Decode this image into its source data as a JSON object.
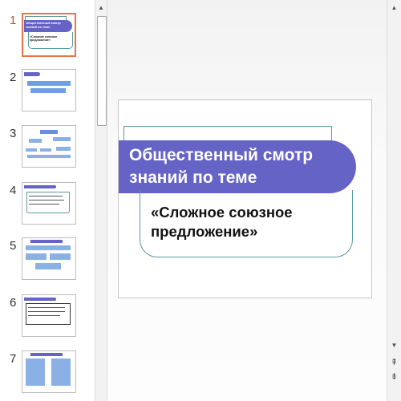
{
  "thumbnails": [
    {
      "number": "1",
      "selected": true,
      "title_text": "Общественный смотр знаний по теме",
      "subtitle_text": "«Сложное союзное предложение»"
    },
    {
      "number": "2",
      "selected": false
    },
    {
      "number": "3",
      "selected": false
    },
    {
      "number": "4",
      "selected": false
    },
    {
      "number": "5",
      "selected": false
    },
    {
      "number": "6",
      "selected": false
    },
    {
      "number": "7",
      "selected": false
    }
  ],
  "slide": {
    "title": "Общественный смотр знаний по теме",
    "subtitle": "«Сложное союзное предложение»"
  },
  "colors": {
    "title_band": "#6563c5",
    "frame": "#5a9a9a",
    "selection_border": "#e87447",
    "selected_number": "#c8502a"
  },
  "scrollbar_glyphs": {
    "up": "▲",
    "down": "▼",
    "prev_slide": "⇞",
    "next_slide": "⇟"
  }
}
